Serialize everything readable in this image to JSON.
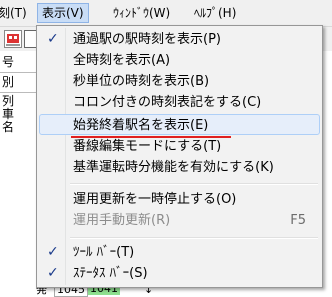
{
  "menubar": {
    "items": [
      {
        "label": "刻(T)"
      },
      {
        "label": "表示(V)"
      },
      {
        "label": "ｳｨﾝﾄﾞｳ(W)"
      },
      {
        "label": "ﾍﾙﾌﾟ(H)"
      }
    ]
  },
  "left_pane": {
    "rows": [
      "号",
      "別",
      "列",
      "車",
      "名"
    ]
  },
  "bottom_row": {
    "cells": [
      "発",
      "1045",
      "1041",
      "↓"
    ]
  },
  "view_menu": {
    "items": [
      {
        "label": "通過駅の駅時刻を表示(P)",
        "checked": true
      },
      {
        "label": "全時刻を表示(A)"
      },
      {
        "label": "秒単位の時刻を表示(B)"
      },
      {
        "label": "コロン付きの時刻表記をする(C)"
      },
      {
        "label": "始発終着駅名を表示(E)",
        "highlighted": true
      },
      {
        "label": "番線編集モードにする(T)"
      },
      {
        "label": "基準運転時分機能を有効にする(K)"
      },
      {
        "label": "運用更新を一時停止する(O)"
      },
      {
        "label": "運用手動更新(R)",
        "shortcut": "F5",
        "disabled": true
      },
      {
        "label": "ﾂｰﾙ ﾊﾞｰ(T)",
        "checked": true
      },
      {
        "label": "ｽﾃｰﾀｽ ﾊﾞｰ(S)",
        "checked": true
      }
    ],
    "check_mark": "✓"
  },
  "colors": {
    "highlight": "#e6eefa",
    "annotation_underline": "#e02020",
    "check": "#1a3a8a"
  }
}
